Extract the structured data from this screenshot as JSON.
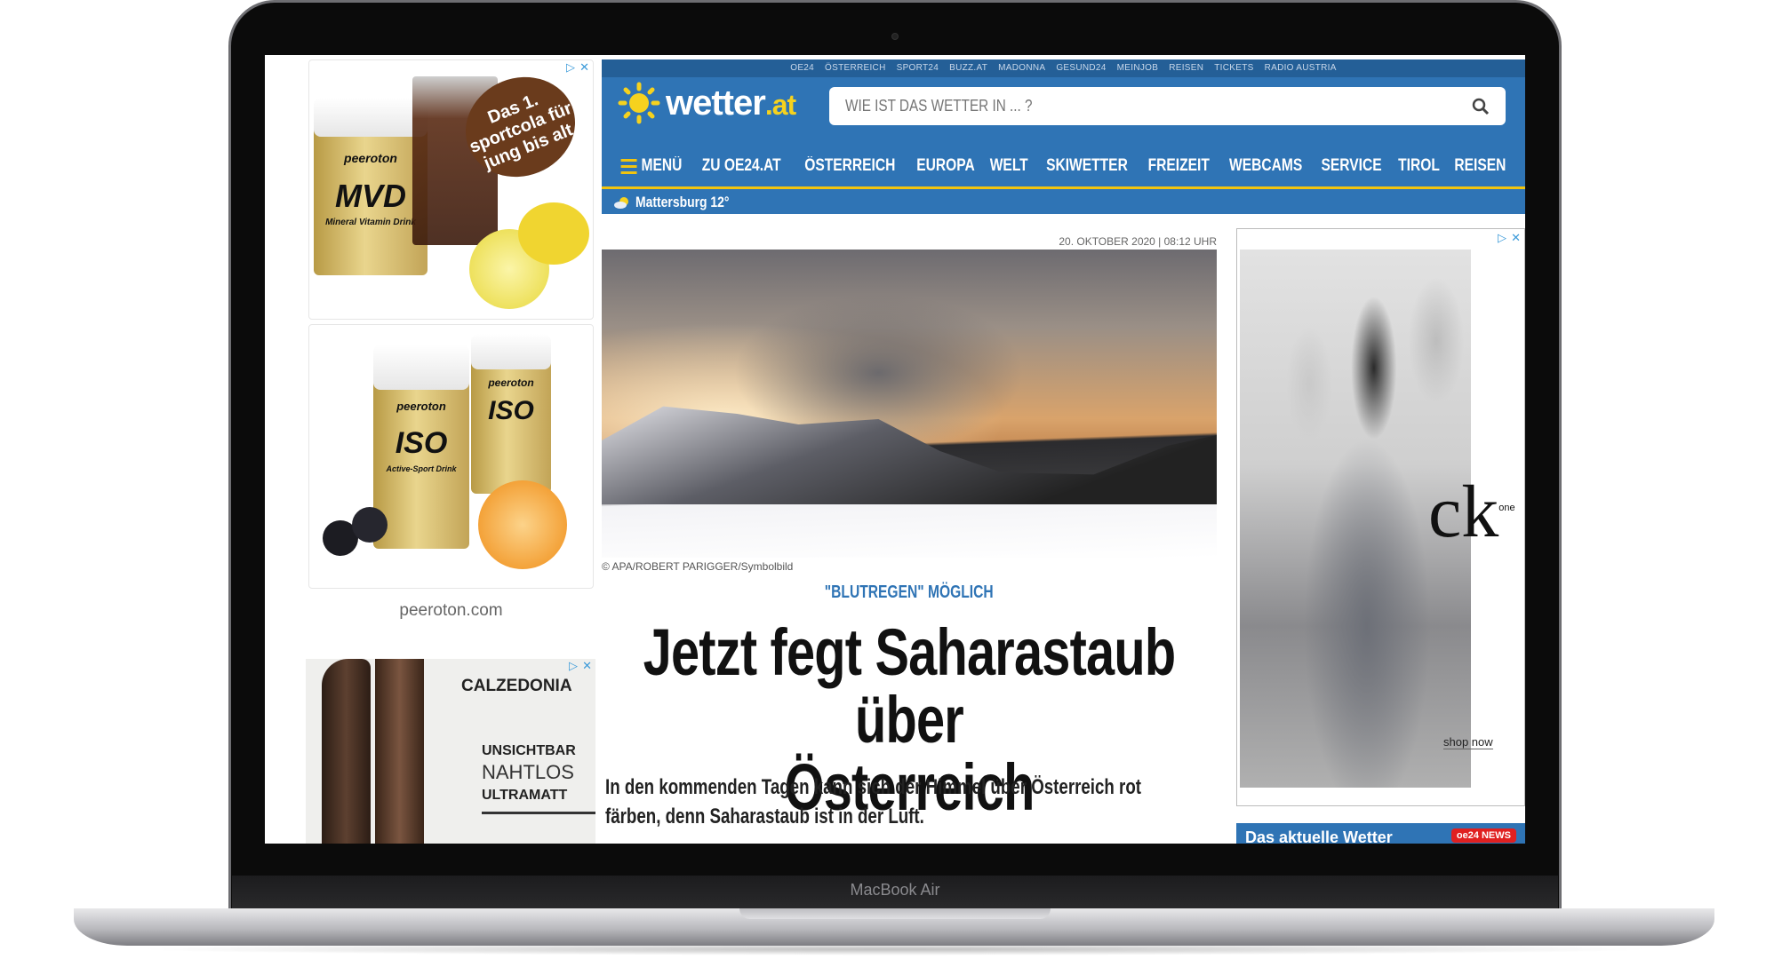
{
  "device": {
    "label": "MacBook Air"
  },
  "ads": {
    "peeroton": {
      "headline": "Das 1. sportcola für jung bis alt",
      "product1": "MVD",
      "product1_sub": "Mineral Vitamin Drink",
      "brand": "peeroton",
      "product2": "ISO",
      "product2_sub": "Active-Sport Drink",
      "domain": "peeroton.com"
    },
    "calzedonia": {
      "brand": "CALZEDONIA",
      "line1": "UNSICHTBAR",
      "line2": "NAHTLOS",
      "line3": "ULTRAMATT"
    },
    "ck": {
      "brand": "ck",
      "sub": "one",
      "cta": "shop now"
    },
    "adchoices": "▷",
    "close": "✕"
  },
  "header": {
    "top_links": [
      "OE24",
      "ÖSTERREICH",
      "SPORT24",
      "BUZZ.AT",
      "MADONNA",
      "GESUND24",
      "MEINJOB",
      "REISEN",
      "TICKETS",
      "RADIO AUSTRIA"
    ],
    "logo_main": "wetter",
    "logo_tld": ".at",
    "search_placeholder": "WIE IST DAS WETTER IN ... ?",
    "menu_label": "MENÜ",
    "nav": [
      "ZU OE24.AT",
      "ÖSTERREICH",
      "EUROPA",
      "WELT",
      "SKIWETTER",
      "FREIZEIT",
      "WEBCAMS",
      "SERVICE",
      "TIROL",
      "REISEN"
    ],
    "location": "Mattersburg 12°"
  },
  "article": {
    "date": "20. OKTOBER 2020 | 08:12 UHR",
    "credit": "© APA/ROBERT PARIGGER/Symbolbild",
    "kicker": "\"BLUTREGEN\" MÖGLICH",
    "title_line1": "Jetzt fegt Saharastaub über",
    "title_line2": "Österreich",
    "lead_line1": "In den kommenden Tagen kann sich der Himmel über Österreich rot",
    "lead_line2": "färben, denn Saharastaub ist in der Luft."
  },
  "sidebar": {
    "weather_box": "Das aktuelle Wetter",
    "badge": "oe24 NEWS"
  },
  "colors": {
    "brand_blue": "#2f74b5",
    "accent_yellow": "#f1c40f"
  }
}
